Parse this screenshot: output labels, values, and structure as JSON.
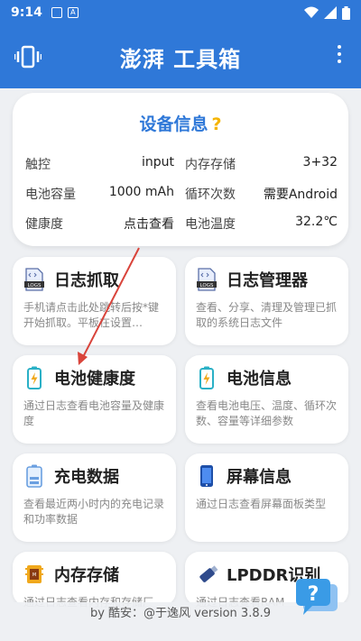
{
  "status_bar": {
    "time": "9:14"
  },
  "appbar": {
    "title": "澎湃 工具箱"
  },
  "device_info": {
    "title": "设备信息",
    "help": "?",
    "rows": [
      [
        {
          "label": "触控",
          "value": "input"
        },
        {
          "label": "内存存储",
          "value": "3+32"
        }
      ],
      [
        {
          "label": "电池容量",
          "value": "1000 mAh"
        },
        {
          "label": "循环次数",
          "value": "需要Android"
        }
      ],
      [
        {
          "label": "健康度",
          "value": "点击查看"
        },
        {
          "label": "电池温度",
          "value": "32.2℃"
        }
      ]
    ]
  },
  "tiles": [
    {
      "title": "日志抓取",
      "desc": "手机请点击此处跳转后按*键开始抓取。平板在设置…",
      "icon": "log-file-icon"
    },
    {
      "title": "日志管理器",
      "desc": "查看、分享、清理及管理已抓取的系统日志文件",
      "icon": "log-file-icon"
    },
    {
      "title": "电池健康度",
      "desc": "通过日志查看电池容量及健康度",
      "icon": "battery-charging-icon"
    },
    {
      "title": "电池信息",
      "desc": "查看电池电压、温度、循环次数、容量等详细参数",
      "icon": "battery-charging-icon"
    },
    {
      "title": "充电数据",
      "desc": "查看最近两小时内的充电记录和功率数据",
      "icon": "battery-data-icon"
    },
    {
      "title": "屏幕信息",
      "desc": "通过日志查看屏幕面板类型",
      "icon": "phone-icon"
    },
    {
      "title": "内存存储",
      "desc": "通过日志查看内存和存储厂",
      "icon": "memory-chip-icon"
    },
    {
      "title": "LPDDR识别",
      "desc": "通过日志查看RAM",
      "icon": "usb-drive-icon"
    }
  ],
  "footer": {
    "text": "by 酷安：@于逸风 version 3.8.9"
  },
  "colors": {
    "primary": "#2f78d8",
    "accent": "#f5b400",
    "arrow": "#d9443b"
  }
}
